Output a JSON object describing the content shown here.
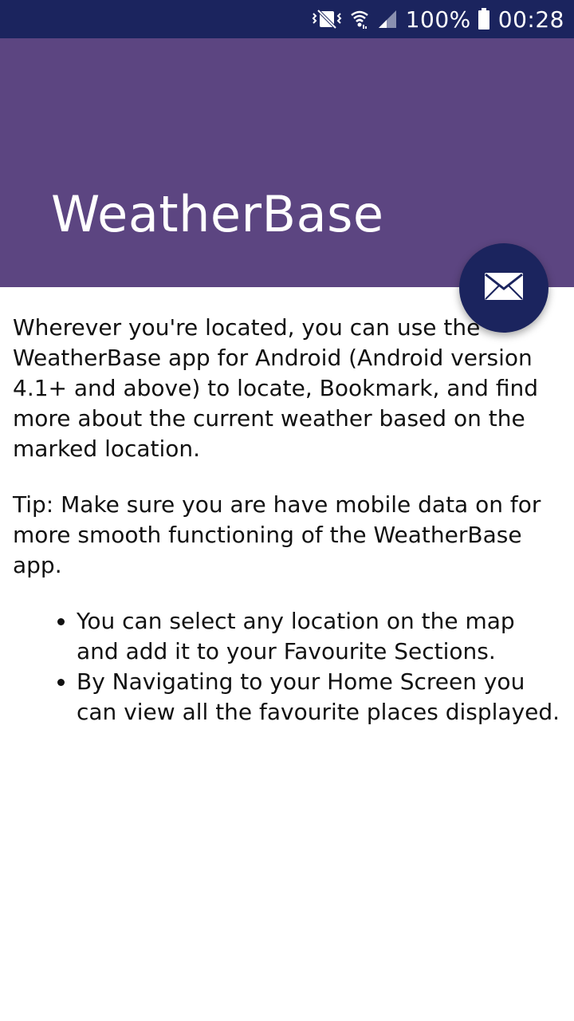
{
  "status_bar": {
    "battery": "100%",
    "time": "00:28",
    "icons": [
      "vibrate-icon",
      "wifi-icon",
      "signal-icon",
      "battery-icon"
    ]
  },
  "toolbar": {
    "title": "WeatherBase"
  },
  "fab": {
    "icon": "mail-icon"
  },
  "body": {
    "intro": "Wherever you're located, you can use the WeatherBase app for Android (Android version 4.1+ and above) to locate, Bookmark, and find more about the current weather based on the marked location.",
    "tip": "Tip: Make sure you are have mobile data on for more smooth functioning of the WeatherBase app.",
    "bullets": [
      "You can select any location on the map and add it to your Favourite Sections.",
      "By Navigating to your Home Screen you can view all the favourite places displayed."
    ]
  },
  "colors": {
    "status_bar": "#1b245e",
    "toolbar": "#5c4581",
    "fab": "#1b245e"
  }
}
